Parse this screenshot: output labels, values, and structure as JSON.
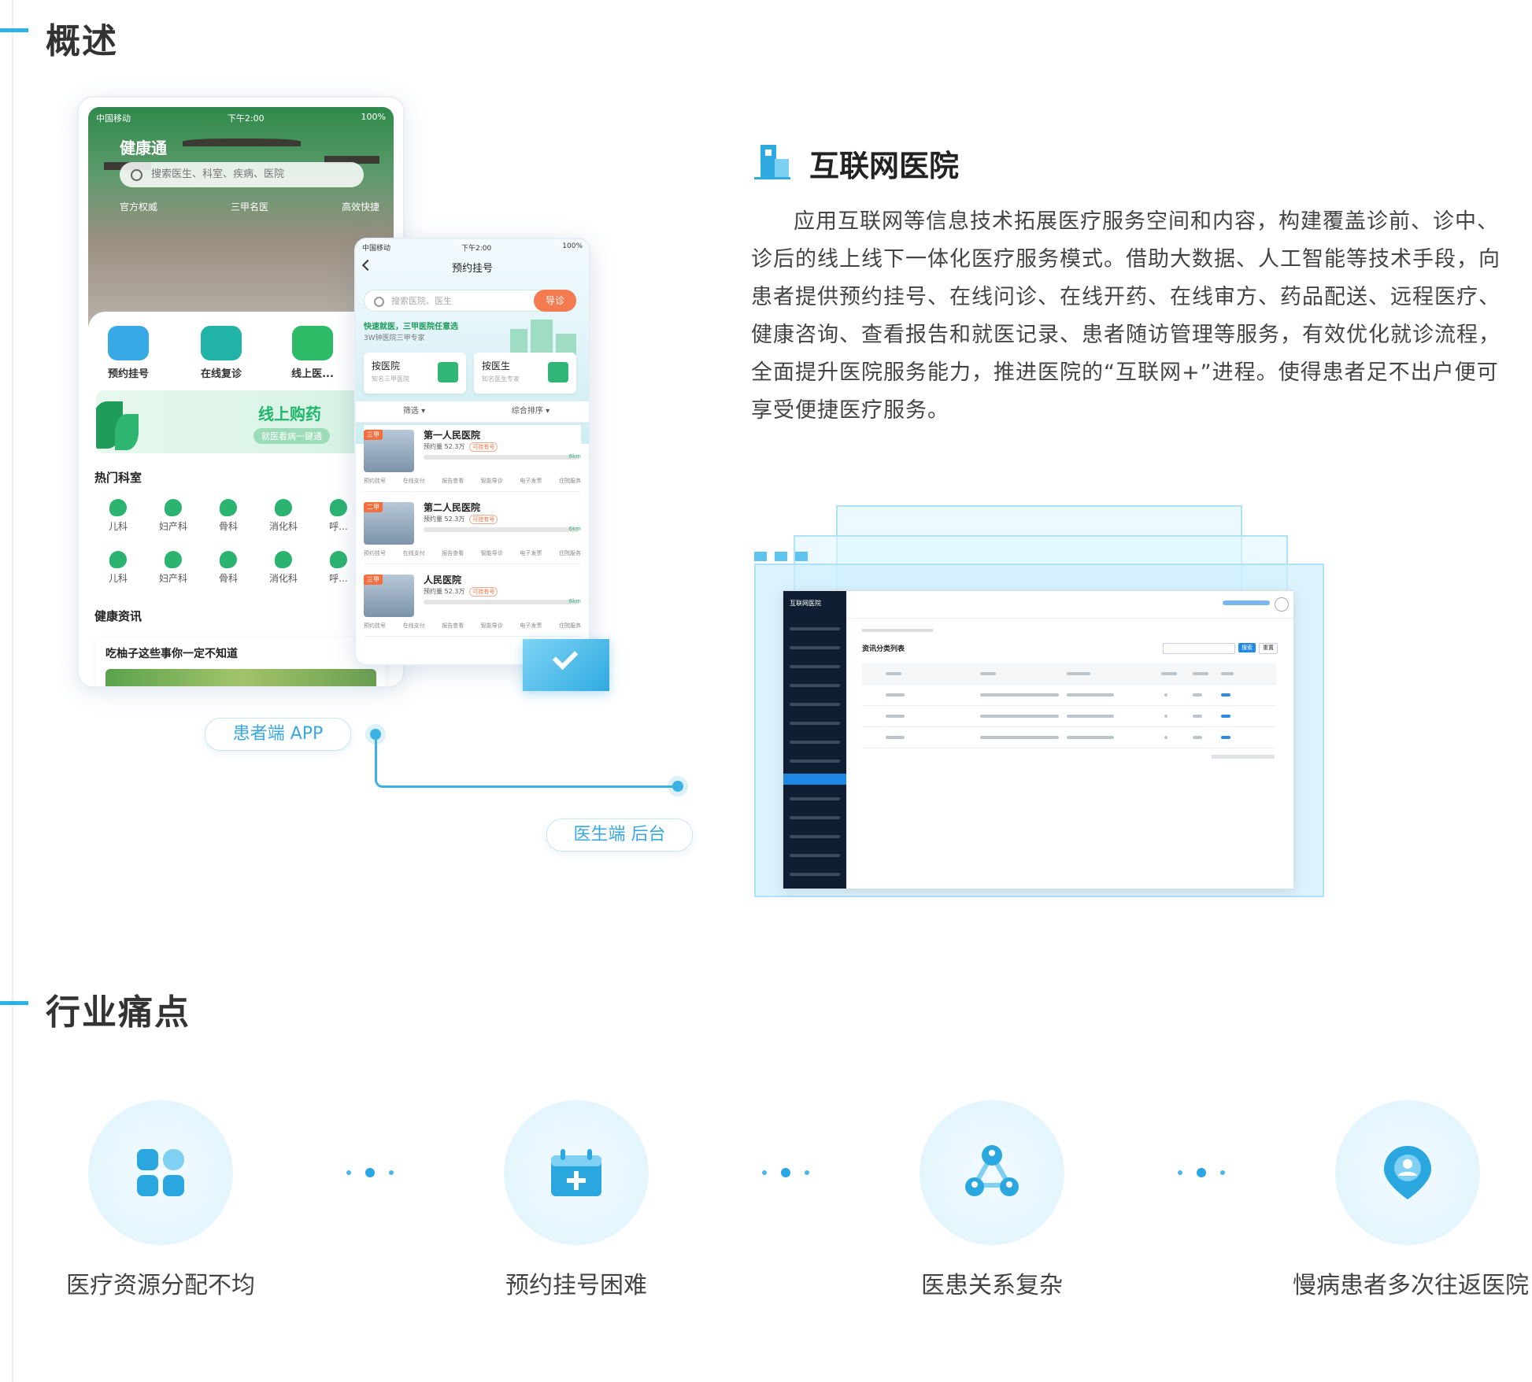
{
  "sections": {
    "overview_title": "概述",
    "pain_title": "行业痛点"
  },
  "phone_app": {
    "status_carrier": "中国移动",
    "status_time": "下午2:00",
    "status_battery": "100%",
    "app_name": "健康通",
    "search_placeholder": "搜索医生、科室、疾病、医院",
    "tags": [
      "官方权威",
      "三甲名医",
      "高效快捷"
    ],
    "quick_actions": [
      "预约挂号",
      "在线复诊",
      "线上医..."
    ],
    "banner_title": "线上购药",
    "banner_subtitle": "就医看病一键通",
    "hot_depts_title": "热门科室",
    "depts": [
      "儿科",
      "妇产科",
      "骨科",
      "消化科",
      "呼..."
    ],
    "news_title": "健康资讯",
    "news_item": "吃柚子这些事你一定不知道"
  },
  "phone_booking": {
    "title": "预约挂号",
    "search_placeholder": "搜索医院、医生",
    "search_button": "导诊",
    "promo": "快速就医，三甲医院任意选",
    "promo_sub": "3W钟医院三甲专家",
    "choice_hospital": "按医院",
    "choice_hospital_sub": "知名三甲医院",
    "choice_doctor": "按医生",
    "choice_doctor_sub": "知名医生专家",
    "filters": [
      "筛选 ▾",
      "综合排序 ▾"
    ],
    "hospitals": [
      {
        "level": "三甲",
        "name": "第一人民医院",
        "visits": "预约量 52.3万",
        "tag": "可挂有号",
        "distance": "6km"
      },
      {
        "level": "二甲",
        "name": "第二人民医院",
        "visits": "预约量 52.3万",
        "tag": "可挂有号",
        "distance": "6km"
      },
      {
        "level": "三甲",
        "name": "人民医院",
        "visits": "预约量 52.3万",
        "tag": "可挂有号",
        "distance": "6km"
      }
    ],
    "services": [
      "预约挂号",
      "在线支付",
      "报告查看",
      "智能导诊",
      "电子发票",
      "住院服务"
    ]
  },
  "labels": {
    "patient_app": "患者端 APP",
    "doctor_admin": "医生端 后台"
  },
  "description": {
    "title": "互联网医院",
    "body": "应用互联网等信息技术拓展医疗服务空间和内容，构建覆盖诊前、诊中、诊后的线上线下一体化医疗服务模式。借助大数据、人工智能等技术手段，向患者提供预约挂号、在线问诊、在线开药、在线审方、药品配送、远程医疗、健康咨询、查看报告和就医记录、患者随访管理等服务，有效优化就诊流程，全面提升医院服务能力，推进医院的“互联网+”进程。使得患者足不出户便可享受便捷医疗服务。"
  },
  "admin": {
    "logo": "互联网医院",
    "page_title": "资讯分类列表",
    "search_button": "搜索",
    "reset_button": "重置"
  },
  "pain_points": [
    {
      "label": "医疗资源分配不均",
      "icon": "grid-icon"
    },
    {
      "label": "预约挂号困难",
      "icon": "calendar-plus-icon"
    },
    {
      "label": "医患关系复杂",
      "icon": "people-network-icon"
    },
    {
      "label": "慢病患者多次往返医院",
      "icon": "location-pin-icon"
    }
  ],
  "colors": {
    "accent": "#2bb2e8",
    "green": "#32b677",
    "orange": "#f47a50"
  }
}
